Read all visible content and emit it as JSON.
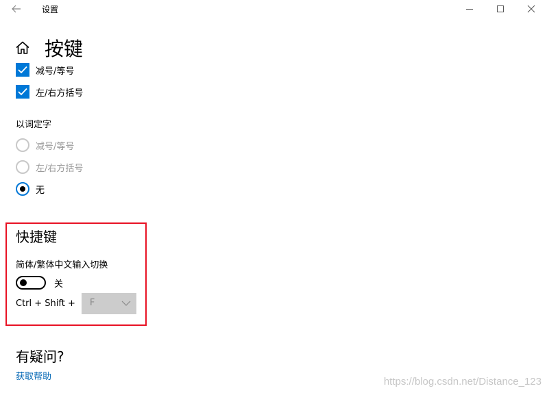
{
  "window": {
    "title": "设置"
  },
  "page": {
    "title": "按键"
  },
  "checkboxes": [
    {
      "label": "减号/等号",
      "checked": true
    },
    {
      "label": "左/右方括号",
      "checked": true
    }
  ],
  "word_select": {
    "label": "以词定字",
    "options": [
      {
        "label": "减号/等号",
        "selected": false,
        "disabled": true
      },
      {
        "label": "左/右方括号",
        "selected": false,
        "disabled": true
      },
      {
        "label": "无",
        "selected": true,
        "disabled": false
      }
    ]
  },
  "shortcuts": {
    "heading": "快捷键",
    "switch_label": "简体/繁体中文输入切换",
    "toggle_state": "关",
    "toggle_on": false,
    "combo_prefix": "Ctrl + Shift +",
    "combo_key": "F"
  },
  "help": {
    "heading": "有疑问?",
    "link": "获取帮助"
  },
  "watermark": "https://blog.csdn.net/Distance_123",
  "colors": {
    "accent": "#0078d7",
    "link": "#0066b4",
    "highlight_border": "#e81123",
    "disabled_text": "#9a9a9a"
  }
}
